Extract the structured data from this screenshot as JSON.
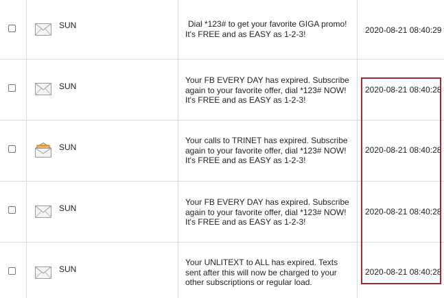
{
  "messages": [
    {
      "sender": "SUN",
      "icon": "envelope-closed-icon",
      "read": true,
      "lines": [
        "Dial *123# to get your favorite GIGA promo!",
        "It's FREE and as EASY as 1-2-3!"
      ],
      "date": "2020-08-21 08:40:29"
    },
    {
      "sender": "SUN",
      "icon": "envelope-closed-icon",
      "read": true,
      "lines": [
        "Your FB EVERY DAY has expired. Subscribe",
        "again to your favorite offer, dial *123# NOW!",
        "It's FREE and as EASY as 1-2-3!"
      ],
      "date": "2020-08-21 08:40:28"
    },
    {
      "sender": "SUN",
      "icon": "envelope-open-icon",
      "read": false,
      "lines": [
        "Your calls to TRINET has expired. Subscribe",
        "again to your favorite offer, dial *123# NOW!",
        "It's FREE and as EASY as 1-2-3!"
      ],
      "date": "2020-08-21 08:40:28"
    },
    {
      "sender": "SUN",
      "icon": "envelope-closed-icon",
      "read": true,
      "lines": [
        "Your FB EVERY DAY has expired. Subscribe",
        "again to your favorite offer, dial *123# NOW!",
        "It's FREE and as EASY as 1-2-3!"
      ],
      "date": "2020-08-21 08:40:28"
    },
    {
      "sender": "SUN",
      "icon": "envelope-closed-icon",
      "read": true,
      "lines": [
        "Your UNLITEXT to ALL has expired. Texts",
        "sent after this will now be charged to your",
        "other subscriptions or regular load."
      ],
      "date": "2020-08-21 08:40:28"
    }
  ],
  "colors": {
    "grid_line": "#d9d9d9",
    "highlight_border": "#a4282f",
    "text": "#222222",
    "open_envelope_accent": "#f0b24a"
  }
}
